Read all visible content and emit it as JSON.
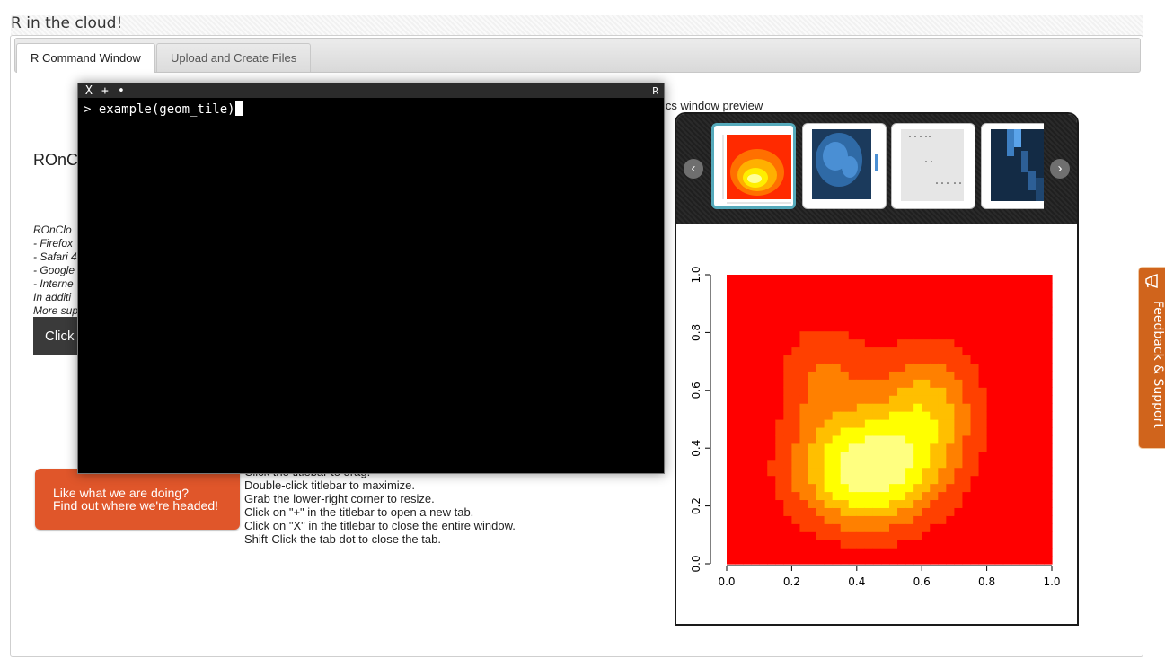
{
  "page": {
    "title": "R in the cloud!"
  },
  "tabs": [
    {
      "label": "R Command Window",
      "active": true
    },
    {
      "label": "Upload and Create Files",
      "active": false
    }
  ],
  "main": {
    "heading_partial": "ROnC",
    "browser_list": [
      "ROnClo",
      "- Firefox",
      "- Safari 4",
      "- Google",
      "- Interne",
      "In additi",
      "More sup"
    ],
    "click_button_partial": "Click",
    "cta": {
      "line1": "Like what we are doing?",
      "line2": "Find out where we're headed!"
    },
    "instructions": [
      "Click the titlebar to drag.",
      "Double-click titlebar to maximize.",
      "Grab the lower-right corner to resize.",
      "Click on \"+\" in the titlebar to open a new tab.",
      "Click on \"X\" in the titlebar to close the entire window.",
      "Shift-Click the tab dot to close the tab."
    ]
  },
  "terminal": {
    "close_glyph": "X",
    "new_tab_glyph": "+",
    "tab_dot_glyph": "•",
    "badge": "R",
    "prompt": "> ",
    "command": "example(geom_tile)"
  },
  "graphics": {
    "preview_label_partial": "ics window preview",
    "prev_glyph": "‹",
    "next_glyph": "›",
    "thumbnails": [
      {
        "name": "heat-colors-density",
        "selected": true
      },
      {
        "name": "blue-density-tiles",
        "selected": false
      },
      {
        "name": "scatter-sparse",
        "selected": false
      },
      {
        "name": "blue-tile-columns",
        "selected": false
      }
    ],
    "palette": [
      "#ff0000",
      "#ff4000",
      "#ff8000",
      "#ffbf00",
      "#ffff00",
      "#ffff80"
    ],
    "accent_thumb_border": "#55aabb"
  },
  "chart_data": {
    "type": "heatmap",
    "xlim": [
      0,
      1
    ],
    "ylim": [
      0,
      1
    ],
    "x_ticks": [
      "0.0",
      "0.2",
      "0.4",
      "0.6",
      "0.8",
      "1.0"
    ],
    "y_ticks": [
      "0.0",
      "0.2",
      "0.4",
      "0.6",
      "0.8",
      "1.0"
    ],
    "xlabel": "",
    "ylabel": "",
    "title": "",
    "grid": false,
    "colormap": "heat (red to yellow)",
    "peak": {
      "x": 0.43,
      "y": 0.32
    },
    "grid_resolution": [
      40,
      36
    ]
  },
  "feedback": {
    "label": "Feedback & Support",
    "color": "#d0641c"
  }
}
